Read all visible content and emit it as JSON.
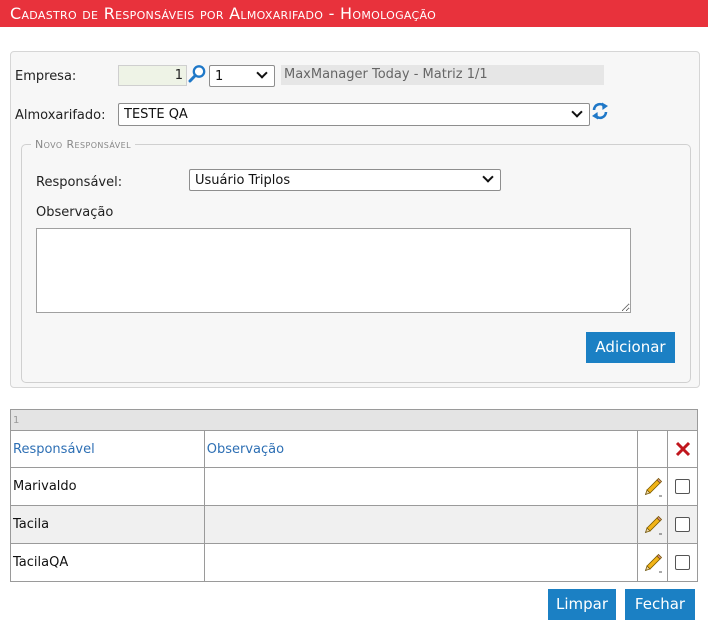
{
  "title": "Cadastro de Responsáveis por Almoxarifado  - Homologação",
  "form": {
    "empresa_label": "Empresa:",
    "empresa_code": "1",
    "empresa_select": "1",
    "empresa_name": "MaxManager Today - Matriz 1/1",
    "almox_label": "Almoxarifado:",
    "almox_value": "TESTE QA"
  },
  "novo": {
    "legend": "Novo Responsável",
    "responsavel_label": "Responsável:",
    "responsavel_value": "Usuário Triplos",
    "observacao_label": "Observação",
    "observacao_value": "",
    "add_button": "Adicionar"
  },
  "grid": {
    "page": "1",
    "columns": {
      "responsavel": "Responsável",
      "observacao": "Observação"
    },
    "rows": [
      {
        "responsavel": "Marivaldo",
        "observacao": ""
      },
      {
        "responsavel": "Tacila",
        "observacao": ""
      },
      {
        "responsavel": "TacilaQA",
        "observacao": ""
      }
    ]
  },
  "buttons": {
    "limpar": "Limpar",
    "fechar": "Fechar"
  },
  "colors": {
    "title_bar": "#e8323c",
    "button": "#1b80c4",
    "link": "#2d6fb4",
    "delete": "#c0161d"
  }
}
